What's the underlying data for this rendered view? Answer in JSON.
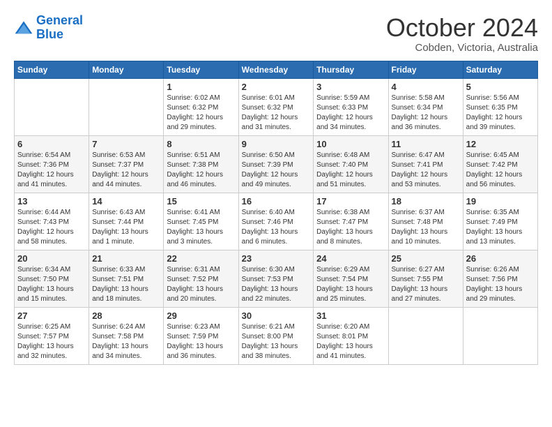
{
  "header": {
    "logo_line1": "General",
    "logo_line2": "Blue",
    "month": "October 2024",
    "location": "Cobden, Victoria, Australia"
  },
  "days_of_week": [
    "Sunday",
    "Monday",
    "Tuesday",
    "Wednesday",
    "Thursday",
    "Friday",
    "Saturday"
  ],
  "weeks": [
    [
      {
        "day": "",
        "info": ""
      },
      {
        "day": "",
        "info": ""
      },
      {
        "day": "1",
        "info": "Sunrise: 6:02 AM\nSunset: 6:32 PM\nDaylight: 12 hours and 29 minutes."
      },
      {
        "day": "2",
        "info": "Sunrise: 6:01 AM\nSunset: 6:32 PM\nDaylight: 12 hours and 31 minutes."
      },
      {
        "day": "3",
        "info": "Sunrise: 5:59 AM\nSunset: 6:33 PM\nDaylight: 12 hours and 34 minutes."
      },
      {
        "day": "4",
        "info": "Sunrise: 5:58 AM\nSunset: 6:34 PM\nDaylight: 12 hours and 36 minutes."
      },
      {
        "day": "5",
        "info": "Sunrise: 5:56 AM\nSunset: 6:35 PM\nDaylight: 12 hours and 39 minutes."
      }
    ],
    [
      {
        "day": "6",
        "info": "Sunrise: 6:54 AM\nSunset: 7:36 PM\nDaylight: 12 hours and 41 minutes."
      },
      {
        "day": "7",
        "info": "Sunrise: 6:53 AM\nSunset: 7:37 PM\nDaylight: 12 hours and 44 minutes."
      },
      {
        "day": "8",
        "info": "Sunrise: 6:51 AM\nSunset: 7:38 PM\nDaylight: 12 hours and 46 minutes."
      },
      {
        "day": "9",
        "info": "Sunrise: 6:50 AM\nSunset: 7:39 PM\nDaylight: 12 hours and 49 minutes."
      },
      {
        "day": "10",
        "info": "Sunrise: 6:48 AM\nSunset: 7:40 PM\nDaylight: 12 hours and 51 minutes."
      },
      {
        "day": "11",
        "info": "Sunrise: 6:47 AM\nSunset: 7:41 PM\nDaylight: 12 hours and 53 minutes."
      },
      {
        "day": "12",
        "info": "Sunrise: 6:45 AM\nSunset: 7:42 PM\nDaylight: 12 hours and 56 minutes."
      }
    ],
    [
      {
        "day": "13",
        "info": "Sunrise: 6:44 AM\nSunset: 7:43 PM\nDaylight: 12 hours and 58 minutes."
      },
      {
        "day": "14",
        "info": "Sunrise: 6:43 AM\nSunset: 7:44 PM\nDaylight: 13 hours and 1 minute."
      },
      {
        "day": "15",
        "info": "Sunrise: 6:41 AM\nSunset: 7:45 PM\nDaylight: 13 hours and 3 minutes."
      },
      {
        "day": "16",
        "info": "Sunrise: 6:40 AM\nSunset: 7:46 PM\nDaylight: 13 hours and 6 minutes."
      },
      {
        "day": "17",
        "info": "Sunrise: 6:38 AM\nSunset: 7:47 PM\nDaylight: 13 hours and 8 minutes."
      },
      {
        "day": "18",
        "info": "Sunrise: 6:37 AM\nSunset: 7:48 PM\nDaylight: 13 hours and 10 minutes."
      },
      {
        "day": "19",
        "info": "Sunrise: 6:35 AM\nSunset: 7:49 PM\nDaylight: 13 hours and 13 minutes."
      }
    ],
    [
      {
        "day": "20",
        "info": "Sunrise: 6:34 AM\nSunset: 7:50 PM\nDaylight: 13 hours and 15 minutes."
      },
      {
        "day": "21",
        "info": "Sunrise: 6:33 AM\nSunset: 7:51 PM\nDaylight: 13 hours and 18 minutes."
      },
      {
        "day": "22",
        "info": "Sunrise: 6:31 AM\nSunset: 7:52 PM\nDaylight: 13 hours and 20 minutes."
      },
      {
        "day": "23",
        "info": "Sunrise: 6:30 AM\nSunset: 7:53 PM\nDaylight: 13 hours and 22 minutes."
      },
      {
        "day": "24",
        "info": "Sunrise: 6:29 AM\nSunset: 7:54 PM\nDaylight: 13 hours and 25 minutes."
      },
      {
        "day": "25",
        "info": "Sunrise: 6:27 AM\nSunset: 7:55 PM\nDaylight: 13 hours and 27 minutes."
      },
      {
        "day": "26",
        "info": "Sunrise: 6:26 AM\nSunset: 7:56 PM\nDaylight: 13 hours and 29 minutes."
      }
    ],
    [
      {
        "day": "27",
        "info": "Sunrise: 6:25 AM\nSunset: 7:57 PM\nDaylight: 13 hours and 32 minutes."
      },
      {
        "day": "28",
        "info": "Sunrise: 6:24 AM\nSunset: 7:58 PM\nDaylight: 13 hours and 34 minutes."
      },
      {
        "day": "29",
        "info": "Sunrise: 6:23 AM\nSunset: 7:59 PM\nDaylight: 13 hours and 36 minutes."
      },
      {
        "day": "30",
        "info": "Sunrise: 6:21 AM\nSunset: 8:00 PM\nDaylight: 13 hours and 38 minutes."
      },
      {
        "day": "31",
        "info": "Sunrise: 6:20 AM\nSunset: 8:01 PM\nDaylight: 13 hours and 41 minutes."
      },
      {
        "day": "",
        "info": ""
      },
      {
        "day": "",
        "info": ""
      }
    ]
  ]
}
